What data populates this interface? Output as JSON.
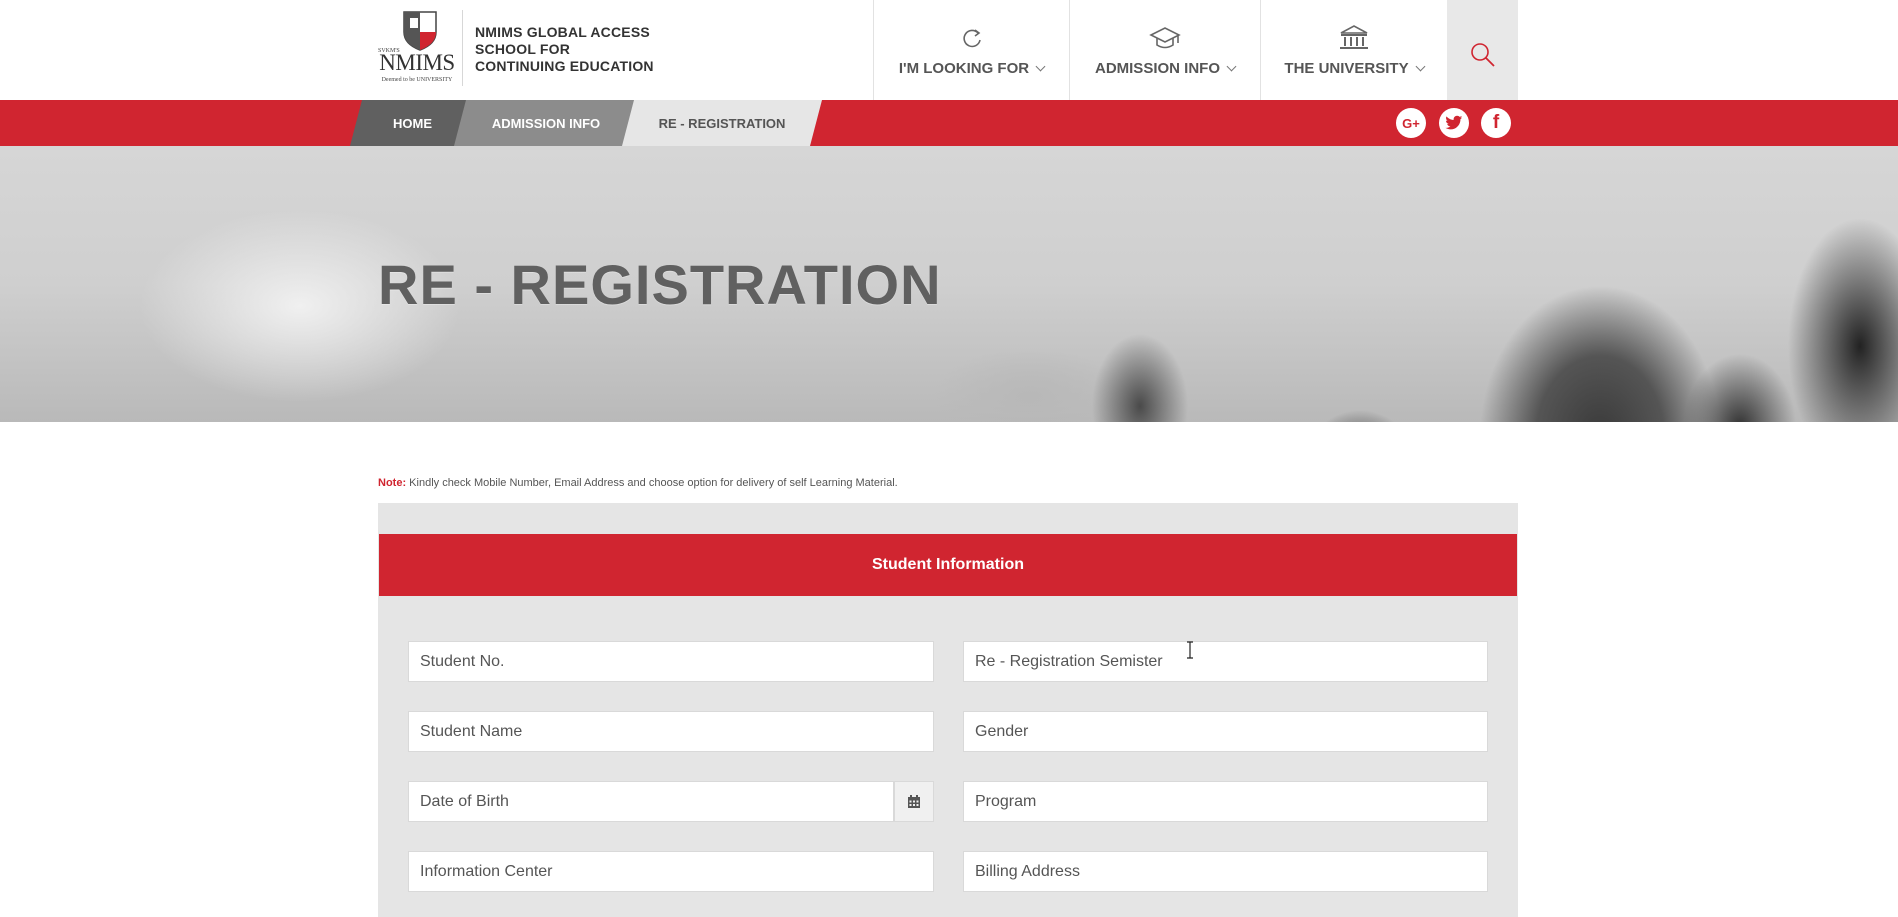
{
  "header": {
    "logo": {
      "top_text": "SVKM'S",
      "brand": "NMIMS",
      "sub_text": "Deemed to be UNIVERSITY"
    },
    "school_name": [
      "NMIMS GLOBAL ACCESS",
      "SCHOOL FOR",
      "CONTINUING EDUCATION"
    ],
    "nav": [
      {
        "label": "I'M LOOKING FOR",
        "icon": "refresh-icon"
      },
      {
        "label": "ADMISSION INFO",
        "icon": "graduation-cap-icon"
      },
      {
        "label": "THE UNIVERSITY",
        "icon": "university-building-icon"
      }
    ],
    "search_icon": "search-icon"
  },
  "breadcrumb": {
    "home": "HOME",
    "section": "ADMISSION INFO",
    "current": "RE - REGISTRATION"
  },
  "social": {
    "google": "G+",
    "twitter": "twitter-icon",
    "facebook": "f"
  },
  "hero": {
    "title": "RE - REGISTRATION"
  },
  "note": {
    "label": "Note:",
    "text": "Kindly check Mobile Number, Email Address and choose option for delivery of self Learning Material."
  },
  "form": {
    "heading": "Student Information",
    "fields": {
      "student_no": "Student No.",
      "re_registration_semester": "Re - Registration Semister",
      "student_name": "Student Name",
      "gender": "Gender",
      "date_of_birth": "Date of Birth",
      "program": "Program",
      "information_center": "Information Center",
      "billing_address": "Billing Address"
    }
  },
  "colors": {
    "brand_red": "#d02530",
    "crumb_home": "#606060",
    "crumb_section": "#8c8c8c",
    "panel_bg": "#e5e5e5"
  }
}
